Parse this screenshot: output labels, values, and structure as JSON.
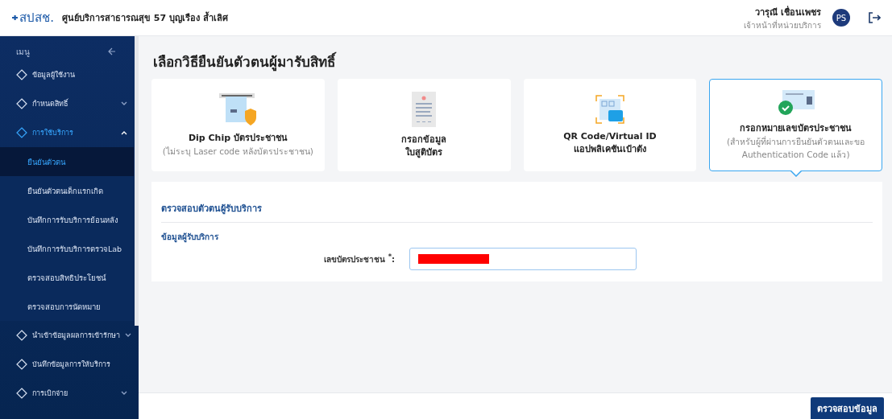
{
  "header": {
    "logo_text": "สปสช.",
    "unit_name": "ศูนย์บริการสาธารณสุข 57 บุญเรือง ล้ำเลิศ",
    "user": {
      "name": "วารุณี เชื่อนเพชร",
      "role": "เจ้าหน้าที่หน่วยบริการ",
      "initials": "PS"
    }
  },
  "sidebar": {
    "title": "เมนู",
    "items": [
      {
        "label": "ข้อมูลผู้ใช้งาน",
        "selected": false
      },
      {
        "label": "กำหนดสิทธิ์",
        "selected": false,
        "expanded": false
      },
      {
        "label": "การใช้บริการ",
        "selected": true,
        "expanded": true,
        "children": [
          {
            "label": "ยืนยันตัวตน",
            "selected": true
          },
          {
            "label": "ยืนยันตัวตนเด็กแรกเกิด",
            "selected": false
          },
          {
            "label": "บันทึกการรับบริการย้อนหลัง",
            "selected": false
          },
          {
            "label": "บันทึกการรับบริการตรวจLab",
            "selected": false
          },
          {
            "label": "ตรวจสอบสิทธิประโยชน์",
            "selected": false
          },
          {
            "label": "ตรวจสอบการนัดหมาย",
            "selected": false
          }
        ]
      },
      {
        "label": "นำเข้าข้อมูลผลการเข้ารักษา",
        "selected": false,
        "expanded": false
      },
      {
        "label": "บันทึกข้อมูลการให้บริการ",
        "selected": false
      },
      {
        "label": "การเบิกจ่าย",
        "selected": false,
        "expanded": false
      }
    ]
  },
  "page_title": "เลือกวิธียืนยันตัวตนผู้มารับสิทธิ์",
  "methods": [
    {
      "kind": "chip",
      "title_lines": [
        "Dip Chip บัตรประชาชน"
      ],
      "note_lines": [
        "(ไม่ระบุ Laser code หลังบัตรประชาชน)"
      ],
      "selected": false
    },
    {
      "kind": "form",
      "title_lines": [
        "กรอกข้อมูล",
        "ใบสูติบัตร"
      ],
      "selected": false
    },
    {
      "kind": "qr",
      "title_lines": [
        "QR Code/Virtual ID",
        "แอปพลิเคชันเป๋าตัง"
      ],
      "selected": false
    },
    {
      "kind": "idcard",
      "title_lines": [
        "กรอกหมายเลขบัตรประชาชน"
      ],
      "note_lines": [
        "(สำหรับผู้ที่ผ่านการยืนยันตัวตนและขอ",
        "Authentication Code แล้ว)"
      ],
      "selected": true
    }
  ],
  "panel": {
    "title": "ตรวจสอบตัวตนผู้รับบริการ",
    "section": "ข้อมูลผู้รับบริการ",
    "field_label": "เลขบัตรประชาชน",
    "required_mark": "*",
    "colon": ":"
  },
  "footer": {
    "button": "ตรวจสอบข้อมูล"
  }
}
